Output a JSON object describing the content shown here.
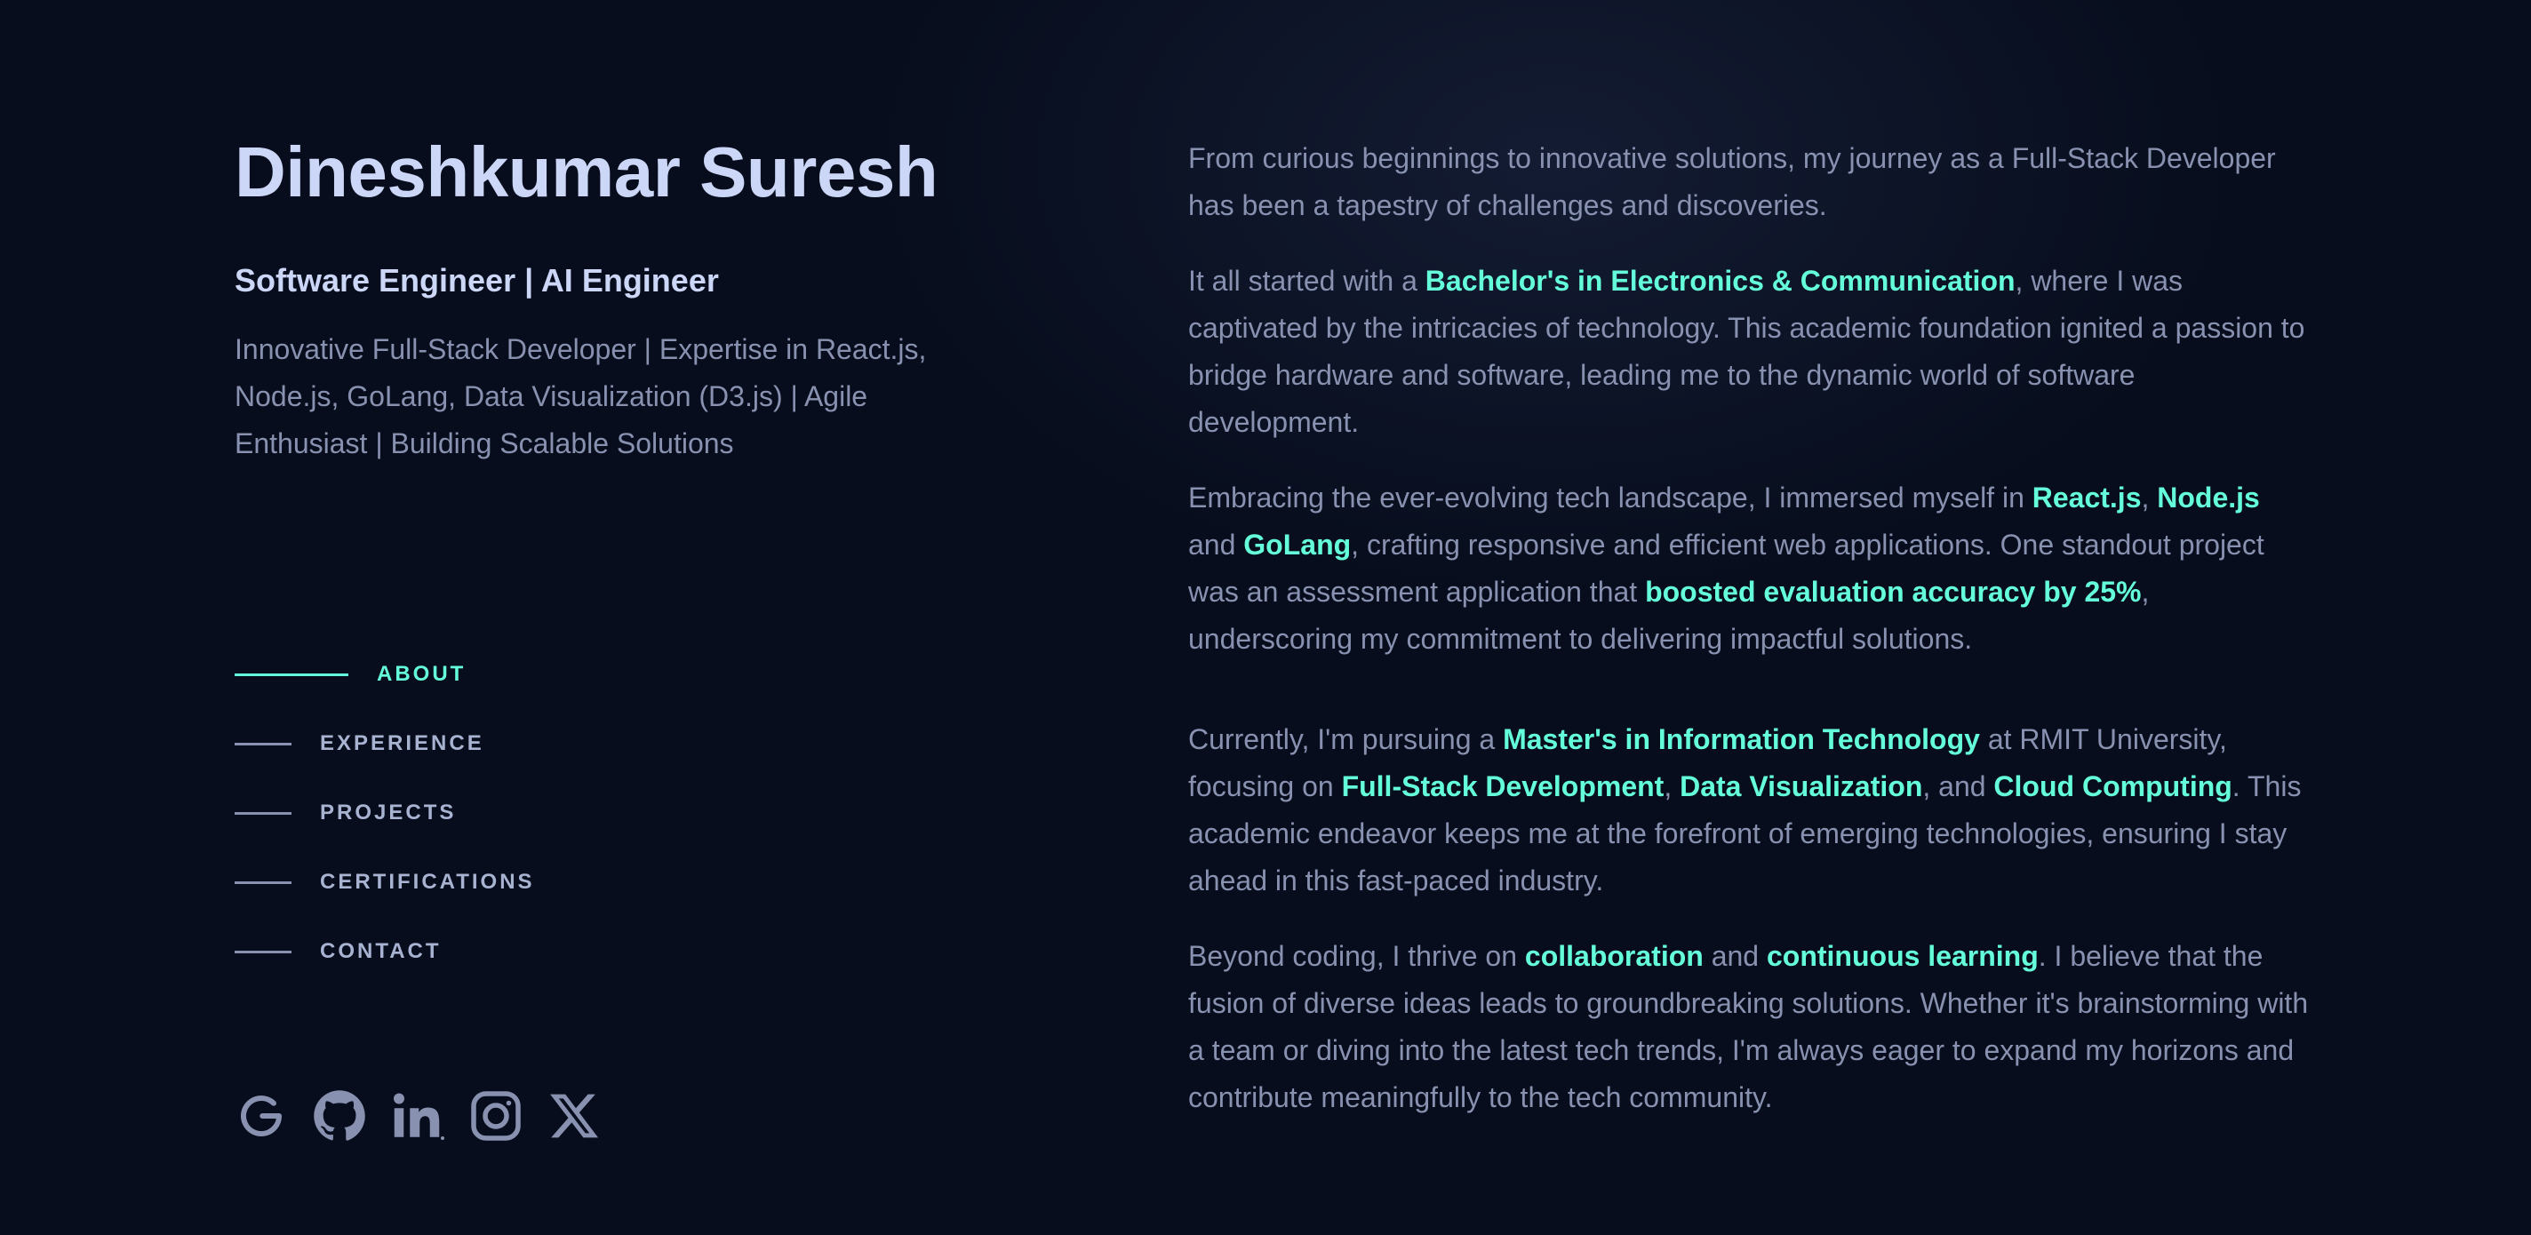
{
  "header": {
    "name": "Dineshkumar Suresh",
    "role": "Software Engineer | AI Engineer",
    "tagline": "Innovative Full-Stack Developer | Expertise in React.js, Node.js, GoLang, Data Visualization (D3.js) | Agile Enthusiast | Building Scalable Solutions"
  },
  "nav": {
    "items": [
      {
        "label": "ABOUT",
        "active": true
      },
      {
        "label": "EXPERIENCE",
        "active": false
      },
      {
        "label": "PROJECTS",
        "active": false
      },
      {
        "label": "CERTIFICATIONS",
        "active": false
      },
      {
        "label": "CONTACT",
        "active": false
      }
    ]
  },
  "social": {
    "icons": [
      "google-icon",
      "github-icon",
      "linkedin-icon",
      "instagram-icon",
      "x-icon"
    ]
  },
  "about": {
    "p1": {
      "text": "From curious beginnings to innovative solutions, my journey as a Full-Stack Developer has been a tapestry of challenges and discoveries."
    },
    "p2": {
      "t1": "It all started with a ",
      "h1": "Bachelor's in Electronics & Communication",
      "t2": ", where I was captivated by the intricacies of technology. This academic foundation ignited a passion to bridge hardware and software, leading me to the dynamic world of software development."
    },
    "p3": {
      "t1": "Embracing the ever-evolving tech landscape, I immersed myself in ",
      "h1": "React.js",
      "t2": ", ",
      "h2": "Node.js",
      "t3": " and ",
      "h3": "GoLang",
      "t4": ", crafting responsive and efficient web applications. One standout project was an assessment application that ",
      "h4": "boosted evaluation accuracy by 25%",
      "t5": ", underscoring my commitment to delivering impactful solutions."
    },
    "p4": {
      "t1": "Currently, I'm pursuing a ",
      "h1": "Master's in Information Technology",
      "t2": " at RMIT University, focusing on ",
      "h2": "Full-Stack Development",
      "t3": ", ",
      "h3": "Data Visualization",
      "t4": ", and ",
      "h4": "Cloud Computing",
      "t5": ". This academic endeavor keeps me at the forefront of emerging technologies, ensuring I stay ahead in this fast-paced industry."
    },
    "p5": {
      "t1": "Beyond coding, I thrive on ",
      "h1": "collaboration",
      "t2": " and ",
      "h2": "continuous learning",
      "t3": ". I believe that the fusion of diverse ideas leads to groundbreaking solutions. Whether it's brainstorming with a team or diving into the latest tech trends, I'm always eager to expand my horizons and contribute meaningfully to the tech community."
    }
  },
  "colors": {
    "background": "#070d1c",
    "heading": "#ccd6f6",
    "body": "#8892b0",
    "accent": "#64ffda"
  }
}
